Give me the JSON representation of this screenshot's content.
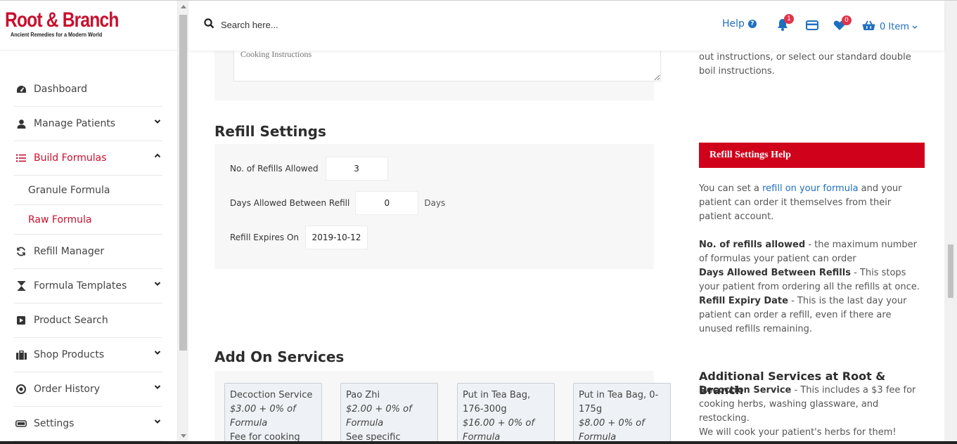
{
  "brand": {
    "name": "Root & Branch",
    "tagline": "Ancient Remedies for a Modern World",
    "accent": "#c8102e"
  },
  "header": {
    "search_placeholder": "Search here...",
    "help_label": "Help",
    "notifications_count": "1",
    "favorites_count": "0",
    "cart_label": "0 Item"
  },
  "sidebar": {
    "items": [
      {
        "label": "Dashboard",
        "icon": "dashboard-icon"
      },
      {
        "label": "Manage Patients",
        "icon": "user-icon"
      },
      {
        "label": "Build Formulas",
        "icon": "list-icon"
      },
      {
        "label": "Refill Manager",
        "icon": "refresh-icon"
      },
      {
        "label": "Formula Templates",
        "icon": "hourglass-icon"
      },
      {
        "label": "Product Search",
        "icon": "play-square-icon"
      },
      {
        "label": "Shop Products",
        "icon": "briefcase-icon"
      },
      {
        "label": "Order History",
        "icon": "circle-icon"
      },
      {
        "label": "Settings",
        "icon": "toggle-icon"
      }
    ],
    "sub_items": [
      {
        "label": "Granule Formula"
      },
      {
        "label": "Raw Formula"
      }
    ]
  },
  "cooking": {
    "placeholder": "Cooking Instructions"
  },
  "refill": {
    "title": "Refill Settings",
    "refills_label": "No. of Refills Allowed",
    "refills_value": "3",
    "days_label": "Days Allowed Between Refill",
    "days_value": "0",
    "days_unit": "Days",
    "expires_label": "Refill Expires On",
    "expires_value": "2019-10-12"
  },
  "addons": {
    "title": "Add On Services",
    "services": [
      {
        "name": "Decoction Service",
        "price": "$3.00 + 0% of Formula",
        "desc": "Fee for cooking"
      },
      {
        "name": "Pao Zhi",
        "price": "$2.00 + 0% of Formula",
        "desc": "See specific"
      },
      {
        "name": "Put in Tea Bag, 176-300g",
        "price": "$16.00 + 0% of Formula",
        "desc": ""
      },
      {
        "name": "Put in Tea Bag, 0-175g",
        "price": "$8.00 + 0% of Formula",
        "desc": ""
      }
    ]
  },
  "help": {
    "top_text": "out instructions, or select our standard double boil instructions.",
    "bar_title": "Refill Settings Help",
    "p1_a": "You can set a ",
    "p1_link": "refill on your formula",
    "p1_b": " and your patient can order it themselves from their patient account.",
    "refills_term": "No. of refills allowed",
    "refills_desc": " - the maximum number of formulas your patient can order",
    "days_term": "Days Allowed Between Refills",
    "days_desc": " -  This stops your patient from ordering all the refills at once.",
    "expiry_term": "Refill Expiry Date",
    "expiry_desc": " -  This is the last day your patient can order a refill, even if there are unused refills remaining.",
    "additional_title": "Additional Services at Root & Branch",
    "decoction_term": "Decoction Service",
    "decoction_desc": " - This includes a $3 fee for cooking herbs, washing glassware, and restocking.",
    "decoction_note": "We will cook your patient's herbs for them!"
  }
}
